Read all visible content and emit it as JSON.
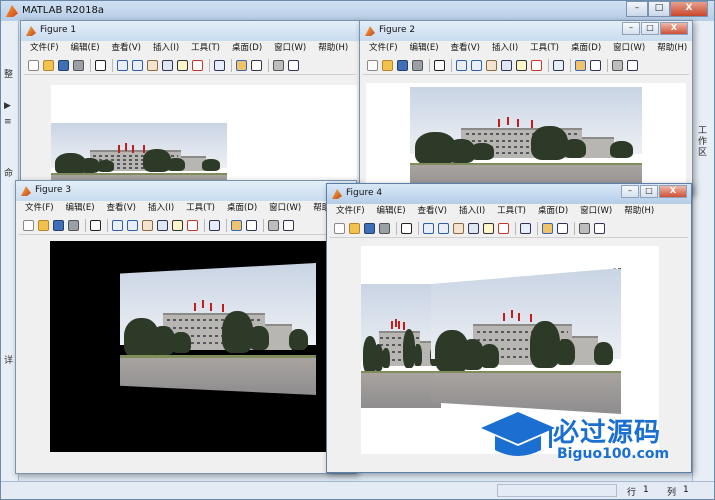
{
  "app": {
    "title": "MATLAB R2018a"
  },
  "main_controls": [
    "–",
    "□",
    "X"
  ],
  "side_right": {
    "vertical_label": "工作区"
  },
  "side_left": {
    "glyphs": [
      "▶",
      "≡",
      "整",
      "命",
      "详"
    ]
  },
  "statusbar": {
    "row_label": "行",
    "row_value": "1",
    "col_label": "列",
    "col_value": "1"
  },
  "figure_menu": [
    "文件(F)",
    "编辑(E)",
    "查看(V)",
    "插入(I)",
    "工具(T)",
    "桌面(D)",
    "窗口(W)",
    "帮助(H)"
  ],
  "figure_controls": [
    "–",
    "□",
    "X"
  ],
  "figures": [
    {
      "title": "Figure 1"
    },
    {
      "title": "Figure 2"
    },
    {
      "title": "Figure 3"
    },
    {
      "title": "Figure 4"
    }
  ],
  "toolbar_icons": [
    "new-file-icon",
    "open-folder-icon",
    "save-icon",
    "print-icon",
    "select-arrow-icon",
    "zoom-in-icon",
    "zoom-out-icon",
    "pan-hand-icon",
    "rotate-3d-icon",
    "data-cursor-icon",
    "brush-icon",
    "link-plot-icon",
    "colorbar-icon",
    "legend-icon",
    "hide-plot-tools-icon",
    "show-plot-tools-icon"
  ],
  "watermark": {
    "brand": "必过源码",
    "url": "Biguo100.com"
  },
  "colors": {
    "titlebar": "#c9dcef",
    "figure_bg": "#f0f0f0",
    "desktop": "#bcd3ea",
    "watermark_blue": "#1a6fd1"
  }
}
